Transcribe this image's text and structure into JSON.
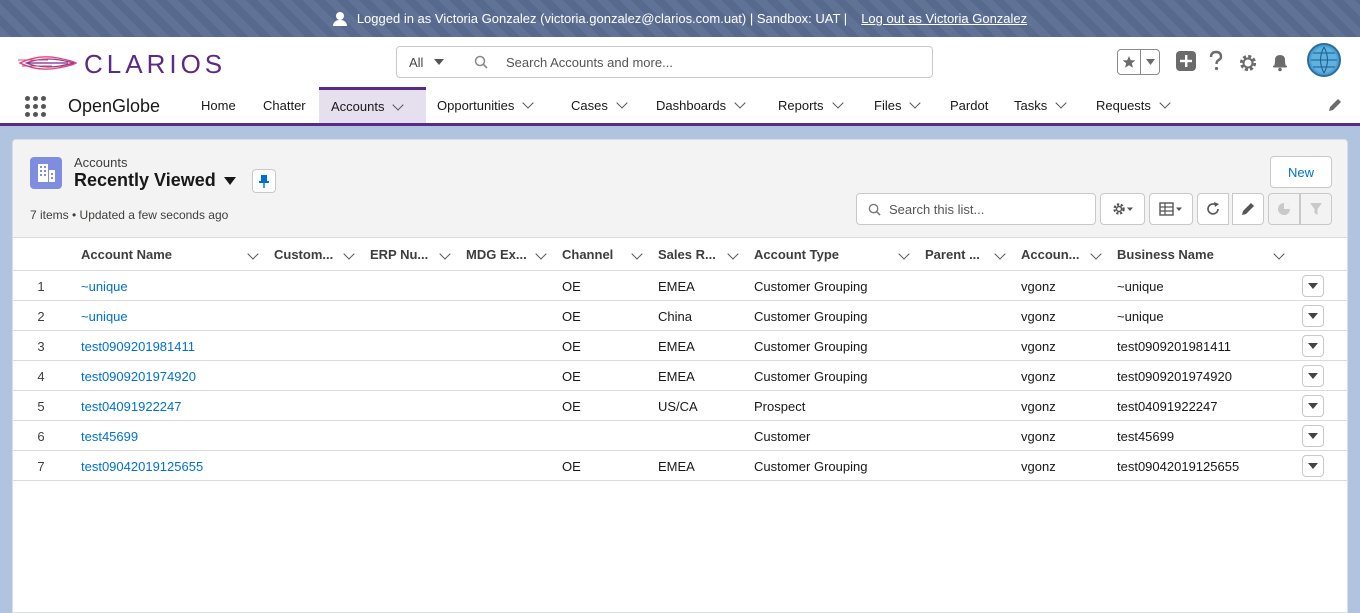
{
  "banner": {
    "text": "Logged in as Victoria Gonzalez (victoria.gonzalez@clarios.com.uat) | Sandbox: UAT |",
    "logout": "Log out as Victoria Gonzalez"
  },
  "header": {
    "logo_text": "CLARIOS",
    "search_scope": "All",
    "search_placeholder": "Search Accounts and more..."
  },
  "nav": {
    "app_name": "OpenGlobe",
    "items": [
      {
        "label": "Home",
        "dropdown": false
      },
      {
        "label": "Chatter",
        "dropdown": false
      },
      {
        "label": "Accounts",
        "dropdown": true,
        "active": true
      },
      {
        "label": "Opportunities",
        "dropdown": true
      },
      {
        "label": "Cases",
        "dropdown": true
      },
      {
        "label": "Dashboards",
        "dropdown": true
      },
      {
        "label": "Reports",
        "dropdown": true
      },
      {
        "label": "Files",
        "dropdown": true
      },
      {
        "label": "Pardot",
        "dropdown": false
      },
      {
        "label": "Tasks",
        "dropdown": true
      },
      {
        "label": "Requests",
        "dropdown": true
      }
    ]
  },
  "list_view": {
    "object_label": "Accounts",
    "name": "Recently Viewed",
    "meta": "7 items • Updated a few seconds ago",
    "new_button": "New",
    "search_placeholder": "Search this list...",
    "columns": [
      "Account Name",
      "Custom...",
      "ERP Nu...",
      "MDG Ex...",
      "Channel",
      "Sales R...",
      "Account Type",
      "Parent ...",
      "Accoun...",
      "Business Name"
    ],
    "rows": [
      {
        "num": "1",
        "account_name": "~unique",
        "channel": "OE",
        "sales_region": "EMEA",
        "account_type": "Customer Grouping",
        "owner": "vgonz",
        "business_name": "~unique"
      },
      {
        "num": "2",
        "account_name": "~unique",
        "channel": "OE",
        "sales_region": "China",
        "account_type": "Customer Grouping",
        "owner": "vgonz",
        "business_name": "~unique"
      },
      {
        "num": "3",
        "account_name": "test0909201981411",
        "channel": "OE",
        "sales_region": "EMEA",
        "account_type": "Customer Grouping",
        "owner": "vgonz",
        "business_name": "test0909201981411"
      },
      {
        "num": "4",
        "account_name": "test0909201974920",
        "channel": "OE",
        "sales_region": "EMEA",
        "account_type": "Customer Grouping",
        "owner": "vgonz",
        "business_name": "test0909201974920"
      },
      {
        "num": "5",
        "account_name": "test04091922247",
        "channel": "OE",
        "sales_region": "US/CA",
        "account_type": "Prospect",
        "owner": "vgonz",
        "business_name": "test04091922247"
      },
      {
        "num": "6",
        "account_name": "test45699",
        "channel": "",
        "sales_region": "",
        "account_type": "Customer",
        "owner": "vgonz",
        "business_name": "test45699"
      },
      {
        "num": "7",
        "account_name": "test09042019125655",
        "channel": "OE",
        "sales_region": "EMEA",
        "account_type": "Customer Grouping",
        "owner": "vgonz",
        "business_name": "test09042019125655"
      }
    ]
  }
}
